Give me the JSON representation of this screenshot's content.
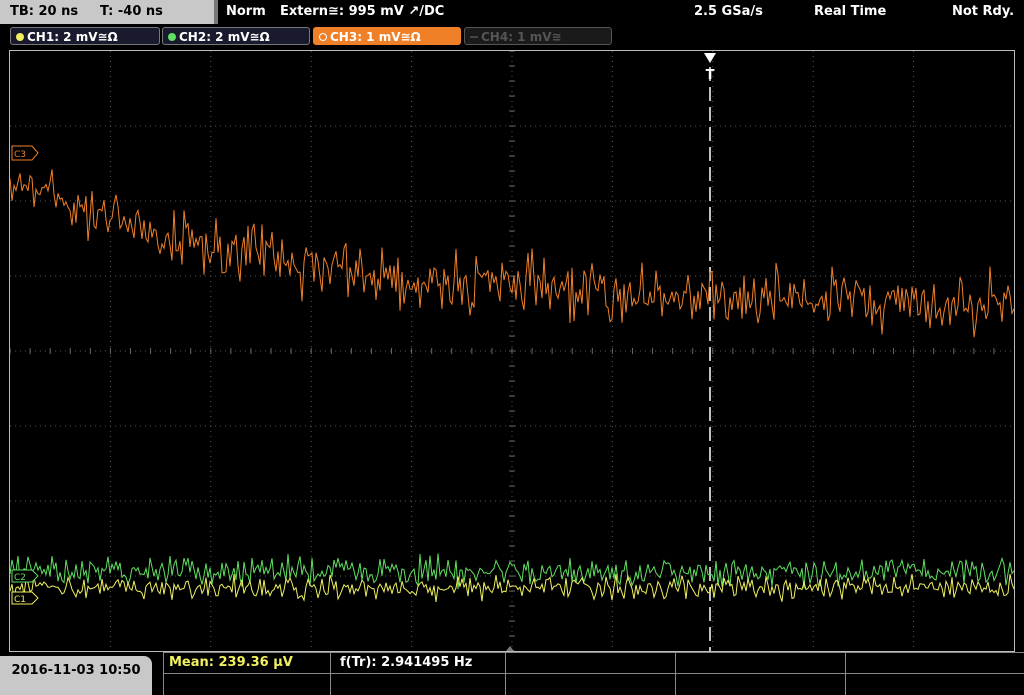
{
  "top": {
    "timebase": "TB: 20 ns",
    "trigger_offset": "T: -40 ns",
    "mode": "Norm",
    "trigger_source": "Extern≅: 995 mV ↗/DC",
    "sample_rate": "2.5 GSa/s",
    "acquisition": "Real Time",
    "status": "Not Rdy."
  },
  "channels": [
    {
      "label": "CH1: 2 mV≅Ω",
      "color": "#f0f060",
      "active": true
    },
    {
      "label": "CH2: 2 mV≅Ω",
      "color": "#60e060",
      "active": true
    },
    {
      "label": "CH3: 1 mV≅Ω",
      "color": "#f08028",
      "active": true
    },
    {
      "label": "CH4: 1 mV≅",
      "color": "#555555",
      "active": false
    }
  ],
  "markers": {
    "ch3": "C3",
    "ch2": "C2",
    "ch1": "C1",
    "trigger": "T"
  },
  "measurements": {
    "mean": "Mean: 239.36 µV",
    "freq": "f(Tr): 2.941495 Hz"
  },
  "datetime": "2016-11-03 10:50",
  "colors": {
    "ch1": "#f0f060",
    "ch2": "#60e060",
    "ch3": "#f08028",
    "grid": "#555555"
  }
}
